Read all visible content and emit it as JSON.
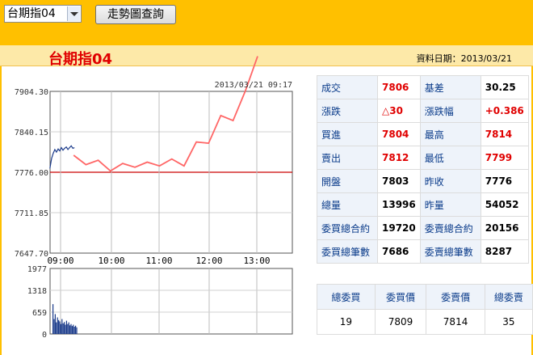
{
  "header": {
    "select_value": "台期指04",
    "query_button": "走勢圖查詢"
  },
  "title": "台期指04",
  "date_label": "資料日期：2013/03/21",
  "chart_timestamp": "2013/03/21 09:17",
  "chart_data": {
    "type": "line",
    "price_y_ticks": [
      "7904.30",
      "7840.15",
      "7776.00",
      "7711.85",
      "7647.70"
    ],
    "price_ylim": [
      7647.7,
      7904.3
    ],
    "reference_price": 7776,
    "x_ticks": [
      "09:00",
      "10:00",
      "11:00",
      "12:00",
      "13:00"
    ],
    "volume_y_ticks": [
      "1977",
      "1318",
      "659",
      "0"
    ],
    "volume_ylim": [
      0,
      1977
    ],
    "series": [
      {
        "color": "#ff6666",
        "x": [
          "09:15",
          "09:30",
          "09:45",
          "10:00",
          "10:15",
          "10:30",
          "10:45",
          "11:00",
          "11:15",
          "11:30",
          "11:45",
          "12:00",
          "12:15",
          "12:30",
          "12:45",
          "13:00"
        ],
        "values": [
          7803,
          7788,
          7795,
          7778,
          7790,
          7784,
          7792,
          7786,
          7797,
          7786,
          7824,
          7822,
          7866,
          7858,
          7905,
          7960
        ]
      },
      {
        "color": "#1a3a8a",
        "x": [
          "08:46",
          "08:48",
          "08:50",
          "08:52",
          "08:54",
          "08:56",
          "08:58",
          "09:00",
          "09:02",
          "09:04",
          "09:06",
          "09:08",
          "09:10",
          "09:12",
          "09:14",
          "09:16"
        ],
        "values": [
          7782,
          7798,
          7806,
          7812,
          7808,
          7813,
          7810,
          7815,
          7811,
          7814,
          7816,
          7812,
          7815,
          7818,
          7814,
          7815
        ]
      }
    ],
    "volume": [
      900,
      450,
      600,
      350,
      500,
      420,
      380,
      300,
      450,
      320,
      360,
      280,
      400,
      300,
      350,
      260,
      300,
      240,
      280,
      220,
      250,
      200
    ]
  },
  "stats": [
    {
      "l1": "成交",
      "v1": "7806",
      "r1": true,
      "l2": "基差",
      "v2": "30.25",
      "r2": false
    },
    {
      "l1": "漲跌",
      "v1": "△30",
      "r1": true,
      "l2": "漲跌幅",
      "v2": "+0.386",
      "r2": true
    },
    {
      "l1": "買進",
      "v1": "7804",
      "r1": true,
      "l2": "最高",
      "v2": "7814",
      "r2": true
    },
    {
      "l1": "賣出",
      "v1": "7812",
      "r1": true,
      "l2": "最低",
      "v2": "7799",
      "r2": true
    },
    {
      "l1": "開盤",
      "v1": "7803",
      "r1": false,
      "l2": "昨收",
      "v2": "7776",
      "r2": false
    },
    {
      "l1": "總量",
      "v1": "13996",
      "r1": false,
      "l2": "昨量",
      "v2": "54052",
      "r2": false
    },
    {
      "l1": "委買總合約",
      "v1": "19720",
      "r1": false,
      "l2": "委賣總合約",
      "v2": "20156",
      "r2": false
    },
    {
      "l1": "委買總筆數",
      "v1": "7686",
      "r1": false,
      "l2": "委賣總筆數",
      "v2": "8287",
      "r2": false
    }
  ],
  "book": {
    "headers": [
      "總委買",
      "委買價",
      "委賣價",
      "總委賣"
    ],
    "values": [
      "19",
      "7809",
      "7814",
      "35"
    ]
  },
  "colors": {
    "accent": "#ffc000",
    "title_red": "#e00000",
    "label_blue": "#0a3b8a",
    "line_red": "#ff6666",
    "line_blue": "#1a3a8a"
  }
}
